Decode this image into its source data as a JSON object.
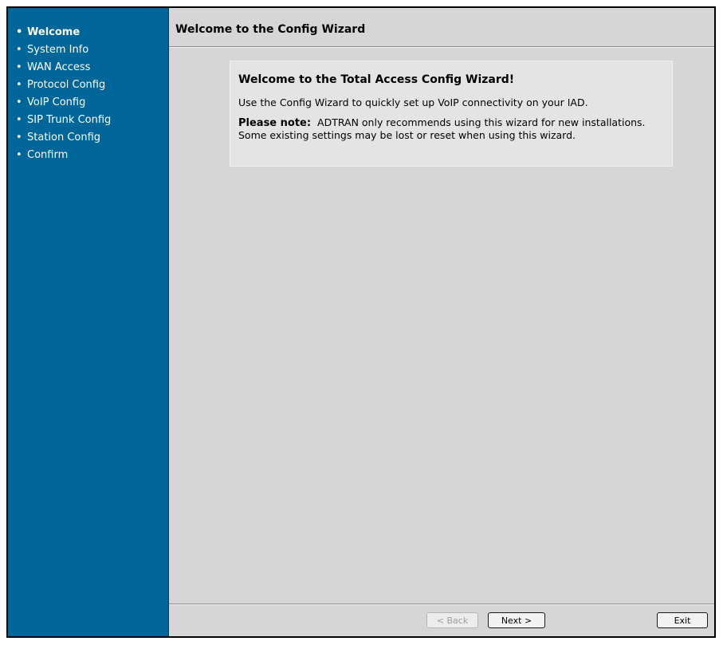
{
  "sidebar": {
    "items": [
      {
        "label": "Welcome",
        "active": true
      },
      {
        "label": "System Info"
      },
      {
        "label": "WAN Access"
      },
      {
        "label": "Protocol Config"
      },
      {
        "label": "VoIP Config"
      },
      {
        "label": "SIP Trunk Config"
      },
      {
        "label": "Station Config"
      },
      {
        "label": "Confirm"
      }
    ],
    "bullet": "•"
  },
  "header": {
    "title": "Welcome to the Config Wizard"
  },
  "welcome": {
    "heading": "Welcome to the Total Access Config Wizard!",
    "intro": "Use the Config Wizard to quickly set up VoIP connectivity on your IAD.",
    "note_label": "Please note:",
    "note_text": "ADTRAN only recommends using this wizard for new installations. Some existing settings may be lost or reset when using this wizard."
  },
  "footer": {
    "back_label": "< Back",
    "next_label": "Next >",
    "exit_label": "Exit",
    "back_disabled": true
  },
  "colors": {
    "sidebar_bg": "#006699",
    "content_bg": "#d6d6d6",
    "box_bg": "#e4e4e4",
    "disabled_text": "#a0a0a0"
  }
}
